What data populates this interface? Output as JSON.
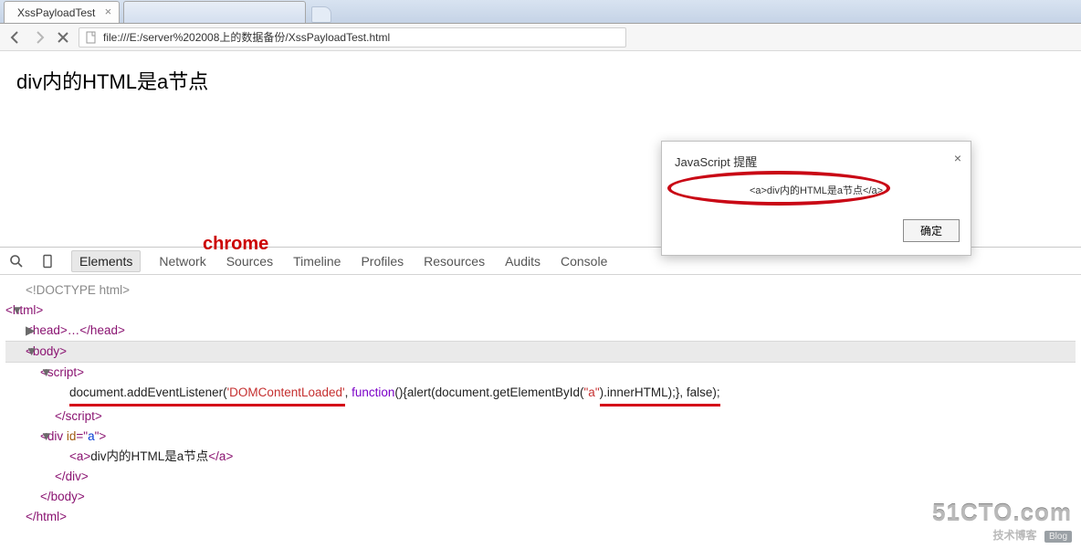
{
  "tabstrip": {
    "tab1": "XssPayloadTest"
  },
  "toolbar": {
    "url": "file:///E:/server%202008上的数据备份/XssPayloadTest.html"
  },
  "page": {
    "title": "div内的HTML是a节点",
    "annotation": "chrome"
  },
  "alert": {
    "heading": "JavaScript 提醒",
    "message": "<a>div内的HTML是a节点</a>",
    "button": "确定"
  },
  "devtools": {
    "tabs": {
      "elements": "Elements",
      "network": "Network",
      "sources": "Sources",
      "timeline": "Timeline",
      "profiles": "Profiles",
      "resources": "Resources",
      "audits": "Audits",
      "console": "Console"
    }
  },
  "dom": {
    "doctype": "<!DOCTYPE html>",
    "html_open": "<html>",
    "head": "<head>…</head>",
    "body_open": "<body>",
    "script_open": "<script>",
    "script_line_prefix": "document.addEventListener(",
    "script_arg1": "'DOMContentLoaded'",
    "script_mid": ", ",
    "script_func": "function",
    "script_paren": "(){alert(document.getElementById(",
    "script_arg2": "\"a\"",
    "script_tail": ").innerHTML);}, false);",
    "script_close": "</script>",
    "div_open_pre": "<div ",
    "div_attr_name": "id",
    "div_attr_eq": "=\"",
    "div_attr_val": "a",
    "div_open_post": "\">",
    "a_open": "<a>",
    "a_text": "div内的HTML是a节点",
    "a_close": "</a>",
    "div_close": "</div>",
    "body_close": "</body>",
    "html_close": "</html>"
  },
  "watermark": {
    "main": "51CTO.com",
    "sub": "技术博客",
    "badge": "Blog"
  }
}
